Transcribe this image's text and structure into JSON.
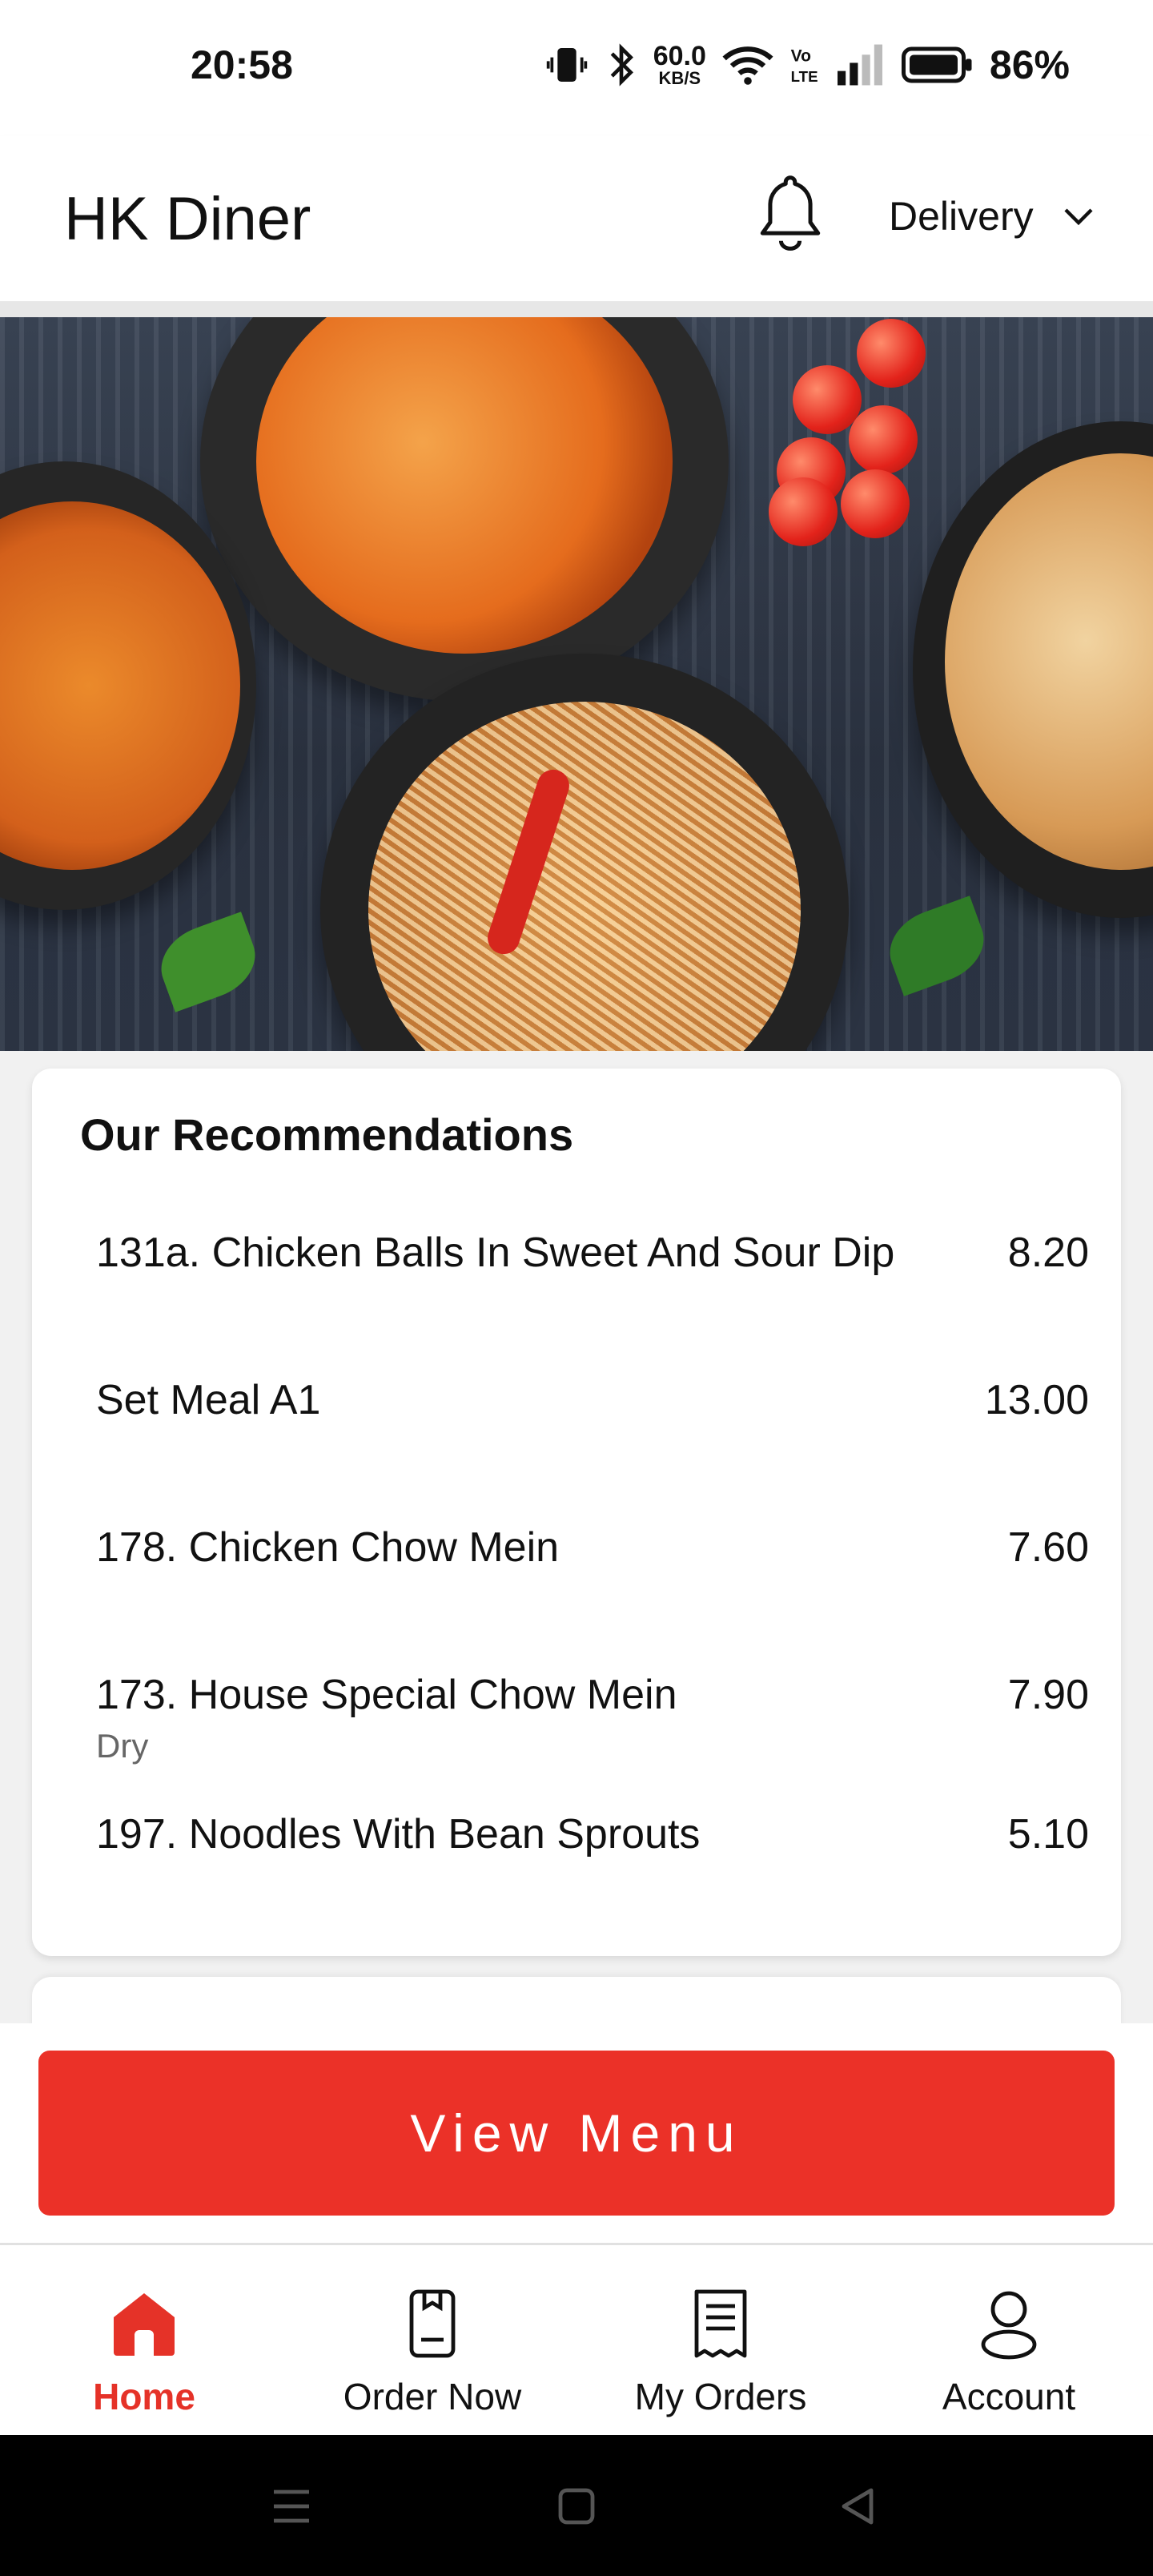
{
  "status_bar": {
    "time": "20:58",
    "net_speed_value": "60.0",
    "net_speed_unit": "KB/S",
    "battery_pct": "86%"
  },
  "header": {
    "title": "HK Diner",
    "mode_label": "Delivery"
  },
  "recommendations": {
    "title": "Our Recommendations",
    "items": [
      {
        "name": "131a. Chicken Balls In Sweet And Sour Dip",
        "price": "8.20",
        "note": ""
      },
      {
        "name": "Set Meal A1",
        "price": "13.00",
        "note": ""
      },
      {
        "name": "178. Chicken Chow Mein",
        "price": "7.60",
        "note": ""
      },
      {
        "name": "173. House Special Chow Mein",
        "price": "7.90",
        "note": "Dry"
      },
      {
        "name": "197. Noodles With Bean Sprouts",
        "price": "5.10",
        "note": ""
      }
    ]
  },
  "cta": {
    "label": "View Menu"
  },
  "bottom_nav": {
    "items": [
      {
        "label": "Home",
        "icon": "home-icon",
        "active": true
      },
      {
        "label": "Order Now",
        "icon": "order-icon",
        "active": false
      },
      {
        "label": "My Orders",
        "icon": "receipt-icon",
        "active": false
      },
      {
        "label": "Account",
        "icon": "user-icon",
        "active": false
      }
    ]
  },
  "colors": {
    "accent": "#eb3128",
    "active_nav": "#e53228"
  }
}
